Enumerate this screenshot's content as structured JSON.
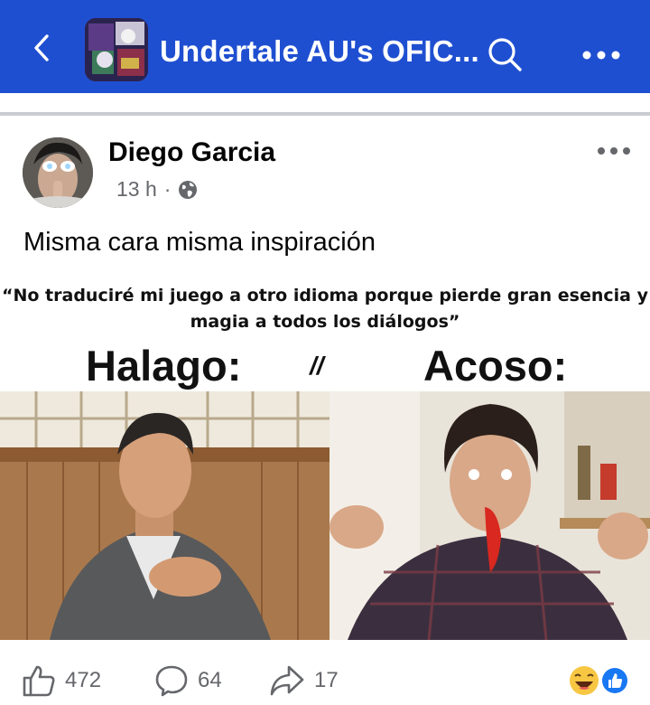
{
  "appbar": {
    "title": "Undertale AU's OFIC...",
    "background": "#1f4fd1"
  },
  "post": {
    "author": "Diego Garcia",
    "time": "13 h",
    "separator": "·",
    "privacy_icon": "globe-icon",
    "text": "Misma cara misma inspiración"
  },
  "meme": {
    "quote": "“No traduciré mi juego a otro idioma porque pierde gran esencia y magia a todos los diálogos”",
    "left_label": "Halago:",
    "separator": "//",
    "right_label": "Acoso:"
  },
  "actions": {
    "likes": "472",
    "comments": "64",
    "shares": "17",
    "reaction_icons": [
      "laughing-emoji-icon",
      "like-reaction-icon"
    ]
  }
}
